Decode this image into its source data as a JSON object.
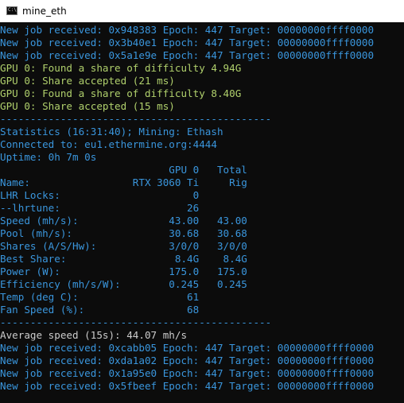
{
  "window": {
    "title": "mine_eth",
    "icon_text": "C:\\",
    "colors": {
      "background": "#0c0c0c",
      "jobs": "#3a96dd",
      "gpu": "#b0d06c",
      "stats": "#3a96dd"
    }
  },
  "lines": [
    "New job received: 0x948383 Epoch: 447 Target: 00000000ffff0000",
    "New job received: 0x3b40e1 Epoch: 447 Target: 00000000ffff0000",
    "New job received: 0x5a1e9e Epoch: 447 Target: 00000000ffff0000",
    "GPU 0: Found a share of difficulty 4.94G",
    "GPU 0: Share accepted (21 ms)",
    "GPU 0: Found a share of difficulty 8.40G",
    "GPU 0: Share accepted (15 ms)",
    "---------------------------------------------",
    "Statistics (16:31:40); Mining: Ethash",
    "Connected to: eu1.ethermine.org:4444",
    "Uptime: 0h 7m 0s",
    "                            GPU 0   Total",
    "Name:                 RTX 3060 Ti     Rig",
    "LHR Locks:                      0",
    "--lhrtune:                     26",
    "Speed (mh/s):               43.00   43.00",
    "Pool (mh/s):                30.68   30.68",
    "Shares (A/S/Hw):            3/0/0   3/0/0",
    "Best Share:                  8.4G    8.4G",
    "Power (W):                  175.0   175.0",
    "Efficiency (mh/s/W):        0.245   0.245",
    "Temp (deg C):                  61",
    "Fan Speed (%):                 68",
    "---------------------------------------------",
    "Average speed (15s): 44.07 mh/s",
    "New job received: 0xcabb05 Epoch: 447 Target: 00000000ffff0000",
    "New job received: 0xda1a02 Epoch: 447 Target: 00000000ffff0000",
    "New job received: 0x1a95e0 Epoch: 447 Target: 00000000ffff0000",
    "New job received: 0x5fbeef Epoch: 447 Target: 00000000ffff0000"
  ]
}
